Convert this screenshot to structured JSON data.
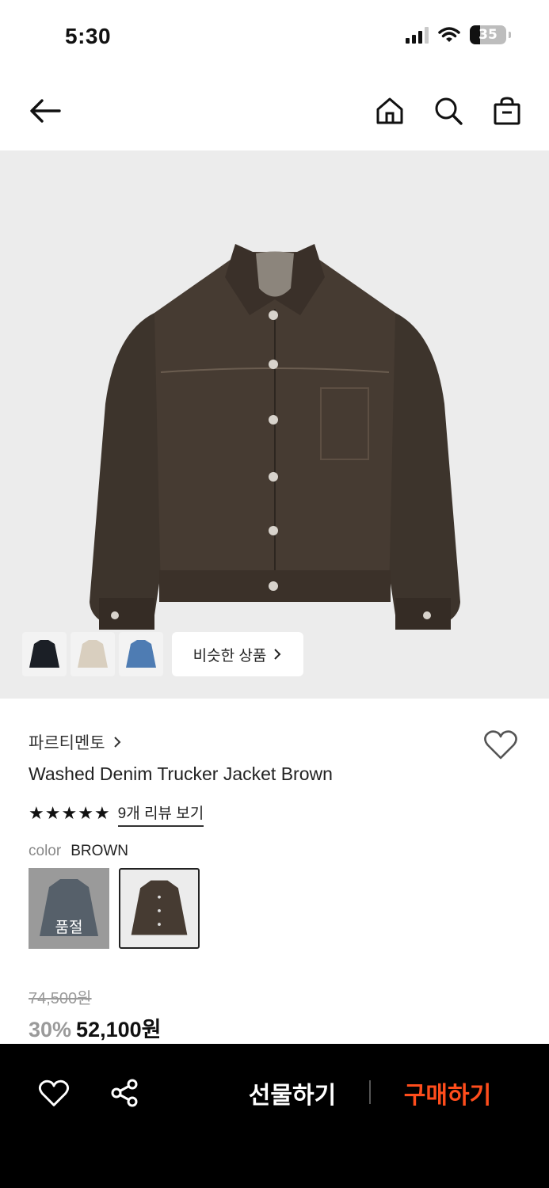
{
  "status_bar": {
    "time": "5:30",
    "battery_percent": "35",
    "icons": [
      "cellular-signal-icon",
      "wifi-icon",
      "battery-icon"
    ]
  },
  "top_nav": {
    "icons": [
      "back-arrow-icon",
      "home-icon",
      "search-icon",
      "shopping-bag-icon"
    ]
  },
  "gallery": {
    "thumbnails": [
      "black-jacket-thumbnail",
      "beige-jacket-thumbnail",
      "blue-denim-jacket-thumbnail"
    ],
    "similar_products_label": "비슷한 상품"
  },
  "product": {
    "brand": "파르티멘토",
    "name": "Washed Denim Trucker Jacket Brown",
    "rating_stars": 5,
    "review_link": "9개 리뷰 보기",
    "color_label": "color",
    "color_value": "BROWN",
    "swatches": [
      {
        "state": "sold out",
        "label": "품절"
      },
      {
        "state": "selected",
        "label": ""
      }
    ],
    "original_price": "74,500원",
    "discount": "30%",
    "sale_price": "52,100원"
  },
  "bottom_bar": {
    "gift_label": "선물하기",
    "buy_label": "구매하기",
    "buy_color": "#ff4d1c",
    "background_color": "#000000"
  }
}
